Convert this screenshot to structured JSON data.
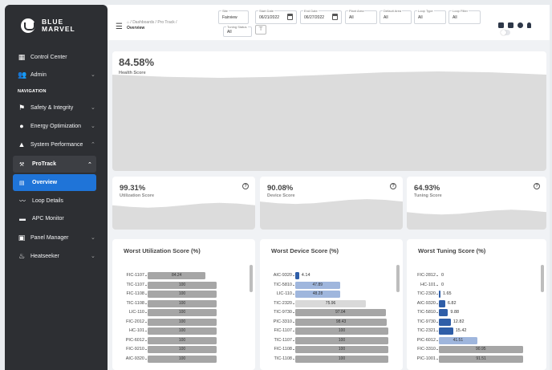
{
  "brand": {
    "line1": "BLUE",
    "line2": "MARVEL"
  },
  "sidebar": {
    "items": [
      {
        "label": "Control Center",
        "icon": "grid-icon"
      },
      {
        "label": "Admin",
        "icon": "users-icon",
        "chevron": "⌄"
      },
      {
        "label": "Safety & Integrity",
        "icon": "shield-user-icon",
        "chevron": "⌄"
      },
      {
        "label": "Energy Optimization",
        "icon": "energy-icon",
        "chevron": "⌄"
      },
      {
        "label": "System Performance",
        "icon": "warning-icon",
        "chevron": "⌃"
      }
    ],
    "section": "NAVIGATION",
    "protrack": {
      "label": "ProTrack",
      "chevron": "⌃"
    },
    "sub_items": [
      {
        "label": "Overview",
        "icon": "chart-icon"
      },
      {
        "label": "Loop Details",
        "icon": "loop-icon"
      },
      {
        "label": "APC Monitor",
        "icon": "monitor-icon"
      }
    ],
    "bottom_items": [
      {
        "label": "Panel Manager",
        "icon": "panel-icon",
        "chevron": "⌄"
      },
      {
        "label": "Heatseeker",
        "icon": "flame-icon",
        "chevron": "⌄"
      }
    ]
  },
  "header": {
    "breadcrumb": "/ Dashboards / Pro Track /",
    "current": "Overview",
    "filters": [
      {
        "label": "Site",
        "value": "Fairview"
      },
      {
        "label": "Start Date",
        "value": "06/21/2022"
      },
      {
        "label": "End Date",
        "value": "06/27/2022"
      },
      {
        "label": "Plant Area",
        "value": "All"
      },
      {
        "label": "Default Area",
        "value": "All"
      },
      {
        "label": "Loop Type",
        "value": "All"
      },
      {
        "label": "Loop Filter",
        "value": "All"
      },
      {
        "label": "Tuning Status",
        "value": "All"
      }
    ]
  },
  "health": {
    "value": "84.58%",
    "label": "Health Score",
    "fill": 0.8458
  },
  "scores": [
    {
      "value": "99.31%",
      "label": "Utilization Score",
      "fill": 0.9931
    },
    {
      "value": "90.08%",
      "label": "Device Score",
      "fill": 0.9008
    },
    {
      "value": "64.93%",
      "label": "Tuning Score",
      "fill": 0.6493
    }
  ],
  "worst": [
    {
      "title": "Worst Utilization Score (%)",
      "rows": [
        {
          "tag": "FIC-1107",
          "value": "84.24",
          "v": 84.24
        },
        {
          "tag": "TIC-1107",
          "value": "100",
          "v": 100
        },
        {
          "tag": "FIC-1108",
          "value": "100",
          "v": 100
        },
        {
          "tag": "TIC-1108",
          "value": "100",
          "v": 100
        },
        {
          "tag": "LIC-110",
          "value": "100",
          "v": 100
        },
        {
          "tag": "FIC-2012",
          "value": "100",
          "v": 100
        },
        {
          "tag": "HC-101",
          "value": "100",
          "v": 100
        },
        {
          "tag": "PIC-6012",
          "value": "100",
          "v": 100
        },
        {
          "tag": "FIC-9210",
          "value": "100",
          "v": 100
        },
        {
          "tag": "AIC-9320",
          "value": "100",
          "v": 100
        }
      ]
    },
    {
      "title": "Worst Device Score (%)",
      "rows": [
        {
          "tag": "AIC-9320",
          "value": "4.14",
          "v": 4.14
        },
        {
          "tag": "TIC-5810",
          "value": "47.89",
          "v": 47.89
        },
        {
          "tag": "LIC-110",
          "value": "48.28",
          "v": 48.28
        },
        {
          "tag": "TIC-2320",
          "value": "75.96",
          "v": 75.96
        },
        {
          "tag": "TIC-9730",
          "value": "97.04",
          "v": 97.04
        },
        {
          "tag": "PIC-3310",
          "value": "98.43",
          "v": 98.43
        },
        {
          "tag": "FIC-1107",
          "value": "100",
          "v": 100
        },
        {
          "tag": "TIC-1107",
          "value": "100",
          "v": 100
        },
        {
          "tag": "FIC-1108",
          "value": "100",
          "v": 100
        },
        {
          "tag": "TIC-1108",
          "value": "100",
          "v": 100
        }
      ]
    },
    {
      "title": "Worst Tuning Score (%)",
      "rows": [
        {
          "tag": "FIC-2812",
          "value": "0",
          "v": 0
        },
        {
          "tag": "HC-101",
          "value": "0",
          "v": 0
        },
        {
          "tag": "TIC-2320",
          "value": "1.65",
          "v": 1.65
        },
        {
          "tag": "AIC-9320",
          "value": "6.82",
          "v": 6.82
        },
        {
          "tag": "TIC-5810",
          "value": "9.88",
          "v": 9.88
        },
        {
          "tag": "TIC-9730",
          "value": "12.82",
          "v": 12.82
        },
        {
          "tag": "TIC-2321",
          "value": "15.42",
          "v": 15.42
        },
        {
          "tag": "PIC-6012",
          "value": "41.51",
          "v": 41.51
        },
        {
          "tag": "FIC-3310",
          "value": "90.95",
          "v": 90.95
        },
        {
          "tag": "PIC-1001",
          "value": "91.51",
          "v": 91.51
        }
      ]
    }
  ],
  "colors": {
    "active": "#1f74d8",
    "sidebar": "#2d2f33",
    "bar_gray": "#a6a6a6",
    "bar_blue_dark": "#2f5ea8",
    "bar_blue_light": "#9fb6dd",
    "bar_light_gray": "#d9d9d9",
    "wave": "#dcdcdc"
  }
}
